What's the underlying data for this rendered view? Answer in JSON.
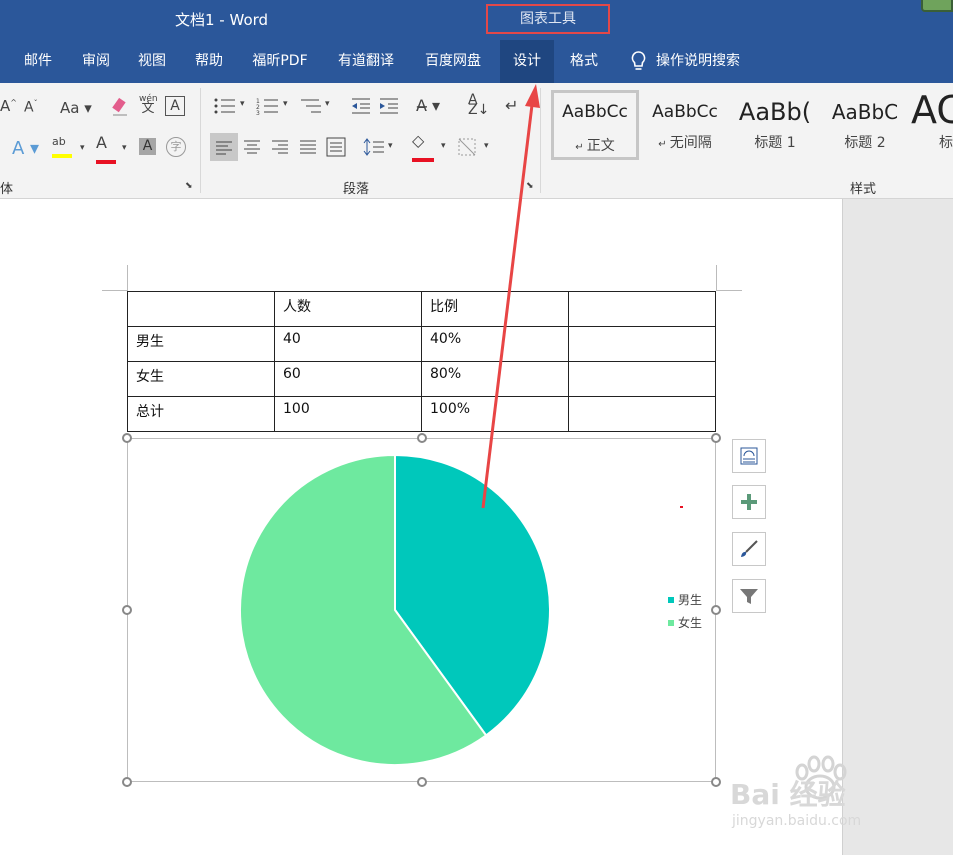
{
  "window": {
    "doc_title": "文档1  -  Word",
    "contextual_tools": "图表工具"
  },
  "menu": {
    "tabs": [
      "邮件",
      "审阅",
      "视图",
      "帮助",
      "福昕PDF",
      "有道翻译",
      "百度网盘",
      "设计",
      "格式"
    ],
    "active_tab": "设计",
    "search_label": "操作说明搜索"
  },
  "ribbon": {
    "font_group_label": "体",
    "paragraph_group_label": "段落",
    "styles_group_label": "样式",
    "case_button": "Aa",
    "phonetic_button": "wén 文",
    "border_char_button": "A",
    "styles": [
      {
        "sample": "AaBbCc",
        "name": "正文"
      },
      {
        "sample": "AaBbCc",
        "name": "无间隔"
      },
      {
        "sample": "AaBb(",
        "name": "标题 1"
      },
      {
        "sample": "AaBbC",
        "name": "标题 2"
      },
      {
        "sample": "AC",
        "name": "标"
      }
    ],
    "colors": {
      "highlight": "#ffff00",
      "font_color": "#e81123",
      "shading": "#e81123"
    }
  },
  "table": {
    "rows": [
      [
        "",
        "人数",
        "比例",
        ""
      ],
      [
        "男生",
        "40",
        "40%",
        ""
      ],
      [
        "女生",
        "60",
        "80%",
        ""
      ],
      [
        "总计",
        "100",
        "100%",
        ""
      ]
    ]
  },
  "chart_data": {
    "type": "pie",
    "series": [
      {
        "values": [
          40,
          60
        ]
      }
    ],
    "categories": [
      "男生",
      "女生"
    ],
    "colors": [
      "#00c8bb",
      "#6ee99f"
    ],
    "legend_position": "right"
  },
  "side_buttons": [
    "layout-options-icon",
    "chart-elements-plus-icon",
    "chart-styles-brush-icon",
    "chart-filter-icon"
  ],
  "watermark": {
    "line1": "Bai 经验",
    "line2": "jingyan.baidu.com"
  }
}
